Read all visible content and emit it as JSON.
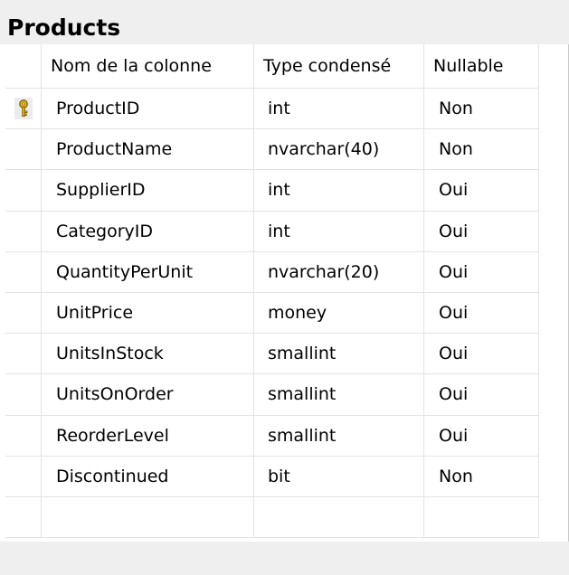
{
  "table": {
    "title": "Products",
    "columns": [
      "Nom de la colonne",
      "Type condensé",
      "Nullable"
    ],
    "rows": [
      {
        "name": "ProductID",
        "type": "int",
        "nullable": "Non",
        "primary_key": true
      },
      {
        "name": "ProductName",
        "type": "nvarchar(40)",
        "nullable": "Non"
      },
      {
        "name": "SupplierID",
        "type": "int",
        "nullable": "Oui"
      },
      {
        "name": "CategoryID",
        "type": "int",
        "nullable": "Oui"
      },
      {
        "name": "QuantityPerUnit",
        "type": "nvarchar(20)",
        "nullable": "Oui"
      },
      {
        "name": "UnitPrice",
        "type": "money",
        "nullable": "Oui"
      },
      {
        "name": "UnitsInStock",
        "type": "smallint",
        "nullable": "Oui"
      },
      {
        "name": "UnitsOnOrder",
        "type": "smallint",
        "nullable": "Oui"
      },
      {
        "name": "ReorderLevel",
        "type": "smallint",
        "nullable": "Oui"
      },
      {
        "name": "Discontinued",
        "type": "bit",
        "nullable": "Non"
      },
      {
        "name": "",
        "type": "",
        "nullable": ""
      }
    ],
    "key_icon": "primary-key-icon",
    "colors": {
      "background": "#efefef",
      "grid": "#ffffff",
      "key": "#f4c21a"
    }
  }
}
